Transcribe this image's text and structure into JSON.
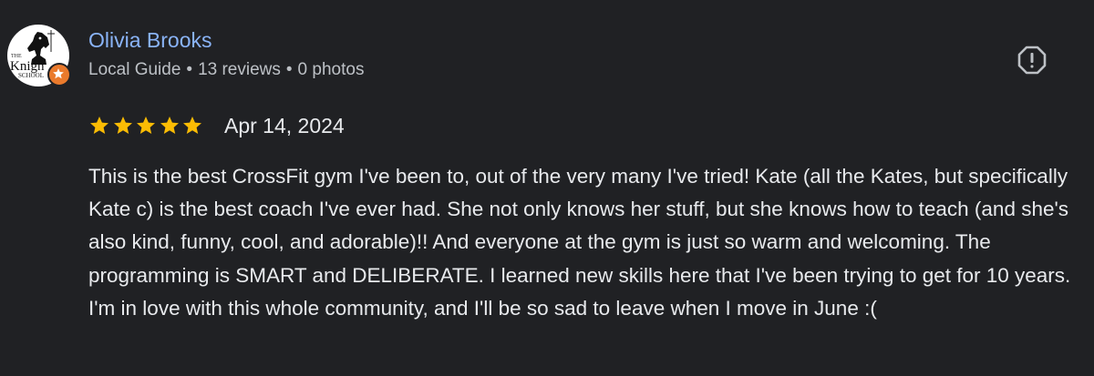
{
  "review": {
    "author": {
      "name": "Olivia Brooks",
      "badge": "Local Guide",
      "reviews": "13 reviews",
      "photos": "0 photos",
      "separator": "•",
      "avatar_icon": "knight-school-logo",
      "badge_icon": "local-guide-star-icon"
    },
    "rating": {
      "stars": 5,
      "max": 5,
      "star_color": "#fbbc04"
    },
    "date": "Apr 14, 2024",
    "text": "This is the best CrossFit gym I've been to, out of the very many I've tried! Kate (all the Kates, but specifically Kate c) is the best coach I've ever had. She not only knows her stuff, but she knows how to teach (and she's also kind, funny, cool, and adorable)!! And everyone at the gym is just so warm and welcoming. The programming is SMART and DELIBERATE. I learned new skills here that I've been trying to get for 10 years. I'm in love with this whole community, and I'll be so sad to leave when I move in June :(",
    "report_icon": "report-flag-icon"
  },
  "colors": {
    "background": "#202124",
    "name": "#8ab4f8",
    "meta": "#bdc1c6",
    "text": "#e8eaed",
    "guide_badge": "#ea7a2c"
  },
  "avatar_logo_text": "The Knight School"
}
